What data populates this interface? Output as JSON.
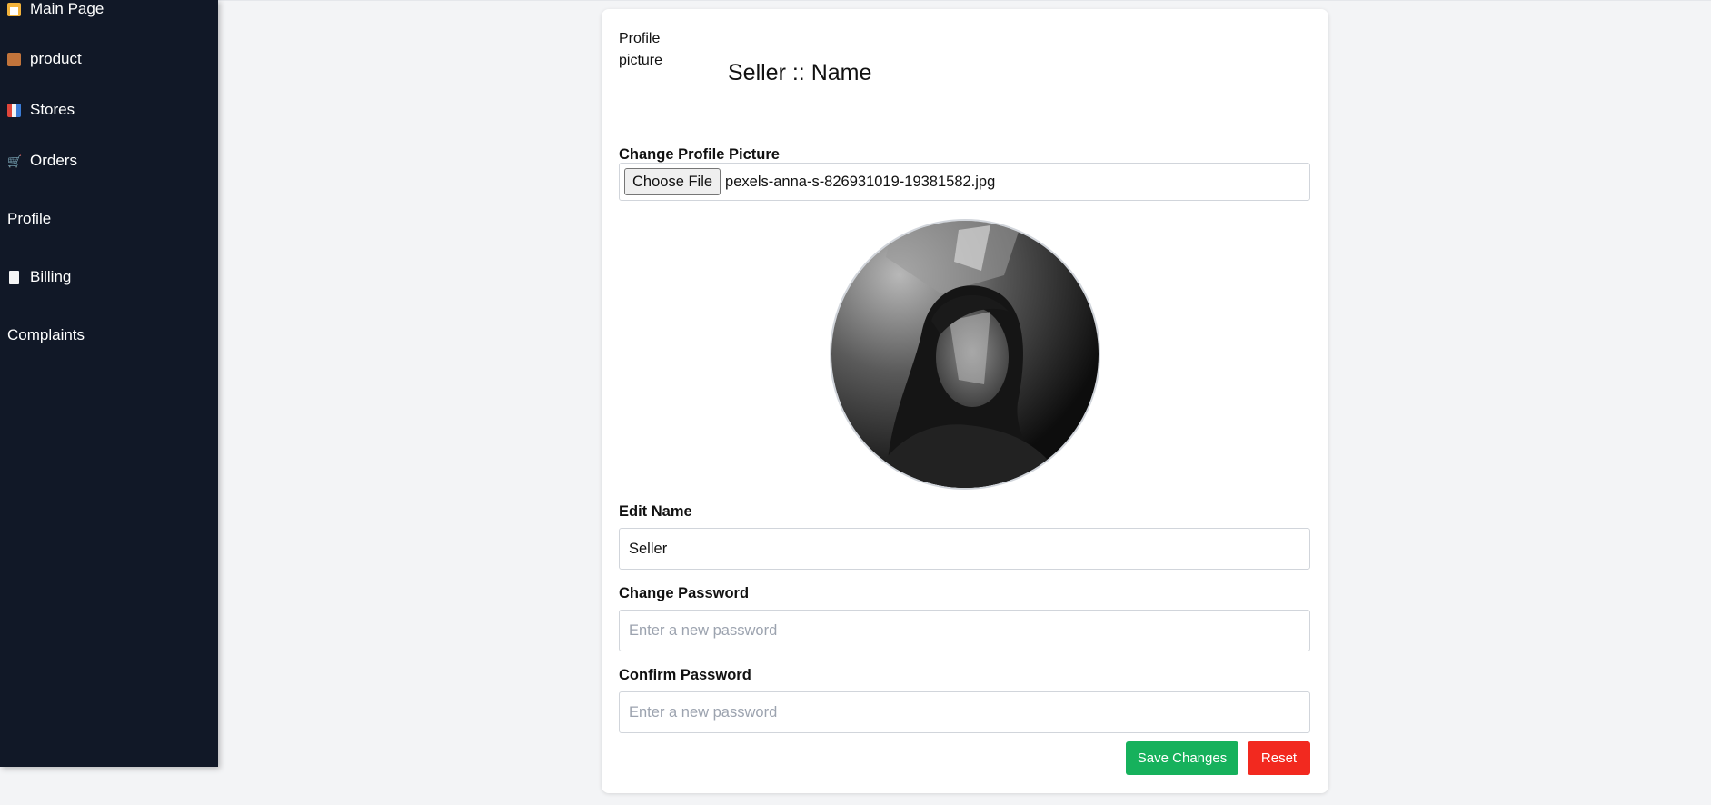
{
  "sidebar": {
    "items": [
      {
        "label": "Main Page",
        "icon": "home-icon"
      },
      {
        "label": "product",
        "icon": "box-icon"
      },
      {
        "label": "Stores",
        "icon": "store-icon"
      },
      {
        "label": "Orders",
        "icon": "cart-icon"
      },
      {
        "label": "Profile",
        "icon": ""
      },
      {
        "label": "Billing",
        "icon": "bill-icon"
      },
      {
        "label": "Complaints",
        "icon": ""
      }
    ]
  },
  "profile": {
    "broken_image_alt": "Profile picture",
    "header_title": "Seller :: Name",
    "change_picture_label": "Change Profile Picture",
    "choose_file_label": "Choose File",
    "file_name": "pexels-anna-s-826931019-19381582.jpg",
    "edit_name_label": "Edit Name",
    "name_value": "Seller",
    "change_password_label": "Change Password",
    "change_password_placeholder": "Enter a new password",
    "confirm_password_label": "Confirm Password",
    "confirm_password_placeholder": "Enter a new password",
    "save_label": "Save Changes",
    "reset_label": "Reset"
  },
  "colors": {
    "sidebar_bg": "#111827",
    "page_bg": "#f3f4f6",
    "save_button": "#16b15c",
    "reset_button": "#f2291f"
  }
}
